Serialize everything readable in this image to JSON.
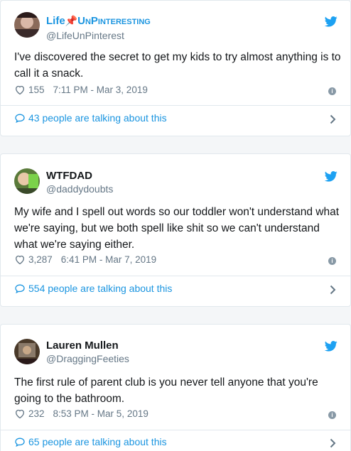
{
  "tweets": [
    {
      "name_prefix": "Life",
      "name_suffix": "UnPinteresting",
      "handle": "@LifeUnPinterest",
      "text": "I've discovered the secret to get my kids to try almost anything is to call it a snack.",
      "likes": "155",
      "timestamp": "7:11 PM - Mar 3, 2019",
      "talking": "43 people are talking about this"
    },
    {
      "name": "WTFDAD",
      "handle": "@daddydoubts",
      "text": "My wife and I spell out words so our toddler won't understand what we're saying, but we both spell like shit so we can't understand what we're saying either.",
      "likes": "3,287",
      "timestamp": "6:41 PM - Mar 7, 2019",
      "talking": "554 people are talking about this"
    },
    {
      "name": "Lauren Mullen",
      "handle": "@DraggingFeeties",
      "text": "The first rule of parent club is you never tell anyone that you're going to the bathroom.",
      "likes": "232",
      "timestamp": "8:53 PM - Mar 5, 2019",
      "talking": "65 people are talking about this"
    }
  ],
  "icons": {
    "bird": "twitter-bird-icon",
    "heart": "heart-icon",
    "info": "info-icon",
    "bubble": "speech-bubble-icon",
    "chevron": "chevron-right-icon",
    "pin": "pushpin-icon"
  },
  "colors": {
    "link_blue": "#1b95e0",
    "twitter_blue": "#1da1f2",
    "muted": "#657786",
    "pin_red": "#e0245e"
  }
}
